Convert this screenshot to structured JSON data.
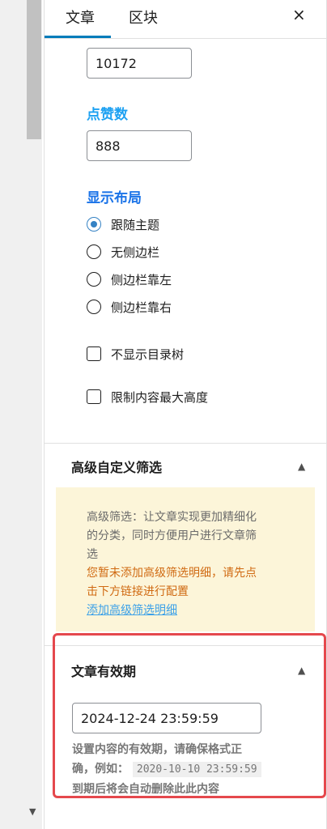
{
  "tabs": {
    "article": "文章",
    "block": "区块"
  },
  "close_icon": "×",
  "fields": {
    "views_value": "10172",
    "likes_label": "点赞数",
    "likes_value": "888"
  },
  "layout": {
    "label": "显示布局",
    "options": [
      "跟随主题",
      "无侧边栏",
      "侧边栏靠左",
      "侧边栏靠右"
    ],
    "selected": "跟随主题"
  },
  "checkboxes": {
    "hide_toc": "不显示目录树",
    "limit_height": "限制内容最大高度"
  },
  "advanced_filter": {
    "title": "高级自定义筛选",
    "desc_line1": "高级筛选：让文章实现更加精细化",
    "desc_line2": "的分类，同时方便用户进行文章筛",
    "desc_line3": "选",
    "warn_line1": "您暂未添加高级筛选明细，请先点",
    "warn_line2": "击下方链接进行配置",
    "link": "添加高级筛选明细"
  },
  "expiry": {
    "title": "文章有效期",
    "value": "2024-12-24 23:59:59",
    "help_line1": "设置内容的有效期，请确保格式正",
    "help_prefix": "确，例如：",
    "help_code": "2020-10-10 23:59:59",
    "help_line3": "到期后将会自动删除此此内容"
  },
  "colors": {
    "accent": "#007cba",
    "label_blue": "#1da1f2",
    "notice_bg": "#fcf5d9",
    "warn": "#d06a12",
    "highlight": "#e5484d"
  }
}
